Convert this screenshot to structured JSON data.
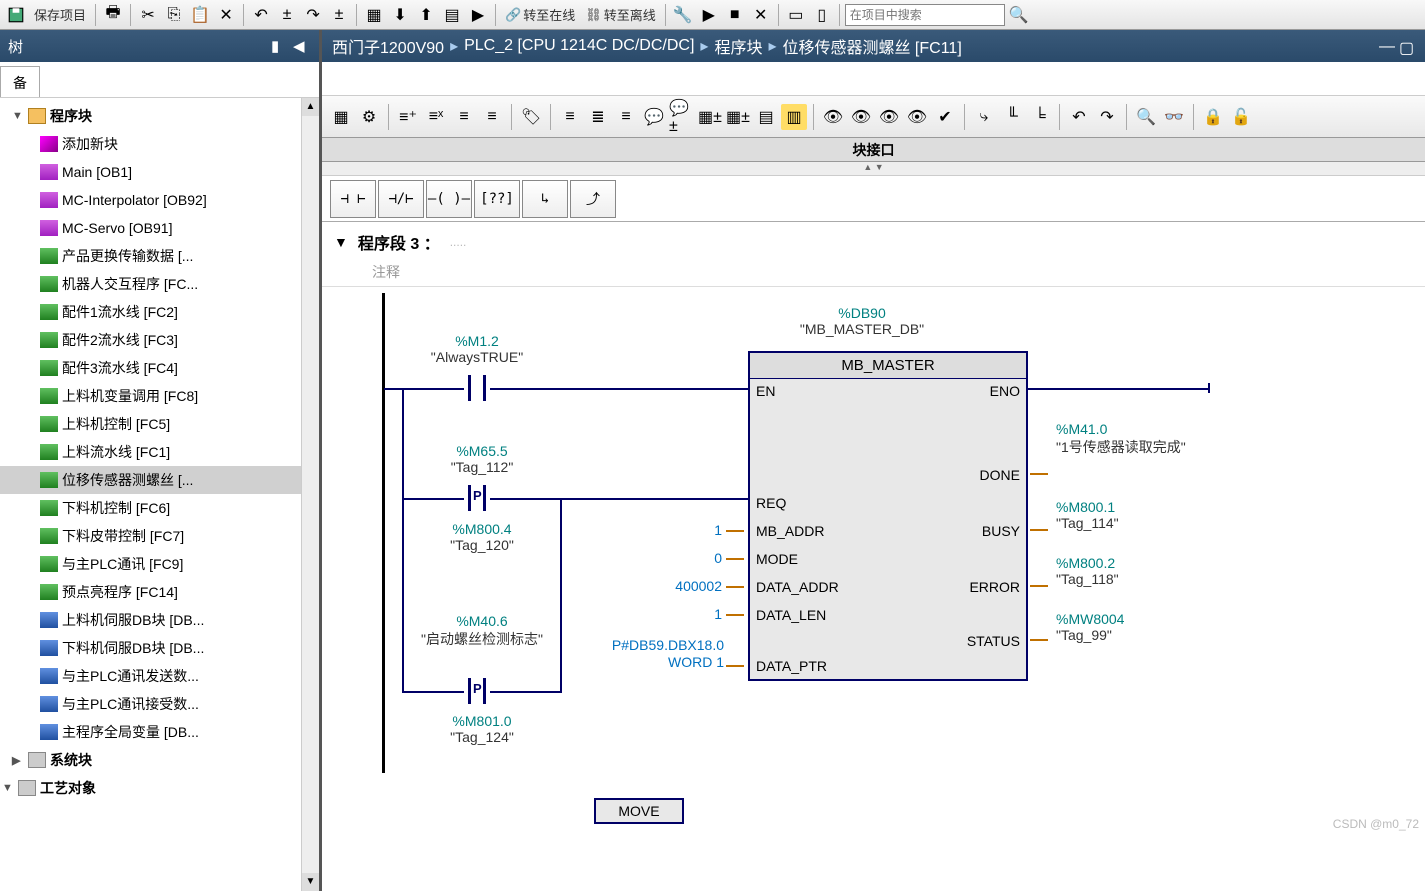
{
  "toolbar": {
    "save_label": "保存项目",
    "online_label": "转至在线",
    "offline_label": "转至离线",
    "search_placeholder": "在项目中搜索"
  },
  "left": {
    "header": "树",
    "tab": "备",
    "groups": {
      "blocks": "程序块",
      "sysblocks": "系统块",
      "tech": "工艺对象"
    },
    "items": [
      {
        "label": "添加新块",
        "icon": "add"
      },
      {
        "label": "Main [OB1]",
        "icon": "ob"
      },
      {
        "label": "MC-Interpolator [OB92]",
        "icon": "ob"
      },
      {
        "label": "MC-Servo [OB91]",
        "icon": "ob"
      },
      {
        "label": "产品更换传输数据 [...",
        "icon": "fc"
      },
      {
        "label": "机器人交互程序 [FC...",
        "icon": "fc"
      },
      {
        "label": "配件1流水线 [FC2]",
        "icon": "fc"
      },
      {
        "label": "配件2流水线 [FC3]",
        "icon": "fc"
      },
      {
        "label": "配件3流水线 [FC4]",
        "icon": "fc"
      },
      {
        "label": "上料机变量调用 [FC8]",
        "icon": "fc"
      },
      {
        "label": "上料机控制 [FC5]",
        "icon": "fc"
      },
      {
        "label": "上料流水线 [FC1]",
        "icon": "fc"
      },
      {
        "label": "位移传感器测螺丝 [...",
        "icon": "fc",
        "selected": true
      },
      {
        "label": "下料机控制 [FC6]",
        "icon": "fc"
      },
      {
        "label": "下料皮带控制 [FC7]",
        "icon": "fc"
      },
      {
        "label": "与主PLC通讯 [FC9]",
        "icon": "fc"
      },
      {
        "label": "预点亮程序 [FC14]",
        "icon": "fc"
      },
      {
        "label": "上料机伺服DB块 [DB...",
        "icon": "db"
      },
      {
        "label": "下料机伺服DB块 [DB...",
        "icon": "db"
      },
      {
        "label": "与主PLC通讯发送数...",
        "icon": "db"
      },
      {
        "label": "与主PLC通讯接受数...",
        "icon": "db"
      },
      {
        "label": "主程序全局变量 [DB...",
        "icon": "db"
      }
    ]
  },
  "breadcrumb": [
    "西门子1200V90",
    "PLC_2 [CPU 1214C DC/DC/DC]",
    "程序块",
    "位移传感器测螺丝 [FC11]"
  ],
  "interface_header": "块接口",
  "lad_tools": [
    "⊣ ⊢",
    "⊣/⊢",
    "–( )–",
    "[??]",
    "↳",
    "⤴"
  ],
  "network": {
    "title_prefix": "程序段",
    "number": "3",
    "colon": "：",
    "dots": ".....",
    "comment": "注释"
  },
  "ladder": {
    "db_addr": "%DB90",
    "db_name": "\"MB_MASTER_DB\"",
    "block_name": "MB_MASTER",
    "contacts": {
      "c1": {
        "addr": "%M1.2",
        "name": "\"AlwaysTRUE\""
      },
      "c2": {
        "addr": "%M65.5",
        "name": "\"Tag_112\""
      },
      "c3": {
        "addr": "%M800.4",
        "name": "\"Tag_120\""
      },
      "c4": {
        "addr": "%M40.6",
        "name": "\"启动螺丝检测标志\""
      },
      "c5": {
        "addr": "%M801.0",
        "name": "\"Tag_124\""
      }
    },
    "pins_left": [
      "EN",
      "REQ",
      "MB_ADDR",
      "MODE",
      "DATA_ADDR",
      "DATA_LEN",
      "DATA_PTR"
    ],
    "pins_right": [
      "ENO",
      "DONE",
      "BUSY",
      "ERROR",
      "STATUS"
    ],
    "in_vals": {
      "MB_ADDR": "1",
      "MODE": "0",
      "DATA_ADDR": "400002",
      "DATA_LEN": "1",
      "DATA_PTR": "P#DB59.DBX18.0 WORD 1"
    },
    "out_vals": {
      "DONE": {
        "addr": "%M41.0",
        "name": "\"1号传感器读取完成\""
      },
      "BUSY": {
        "addr": "%M800.1",
        "name": "\"Tag_114\""
      },
      "ERROR": {
        "addr": "%M800.2",
        "name": "\"Tag_118\""
      },
      "STATUS": {
        "addr": "%MW8004",
        "name": "\"Tag_99\""
      }
    },
    "move_label": "MOVE"
  },
  "watermark": "CSDN @m0_72"
}
